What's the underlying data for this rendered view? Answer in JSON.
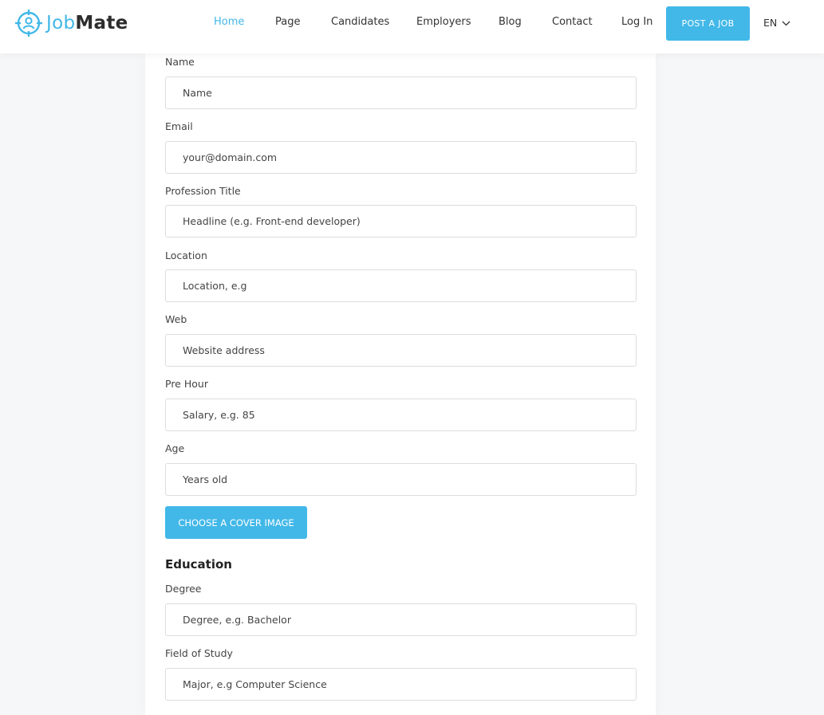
{
  "brand": {
    "part1": "Job",
    "part2": "Mate",
    "accent": "#42b8e8",
    "icon": "target-person-icon"
  },
  "nav": {
    "items": [
      {
        "label": "Home",
        "active": true
      },
      {
        "label": "Page"
      },
      {
        "label": "Candidates"
      },
      {
        "label": "Employers"
      },
      {
        "label": "Blog"
      },
      {
        "label": "Contact"
      },
      {
        "label": "Log In"
      }
    ],
    "post_job": "POST A JOB",
    "language": "EN",
    "language_icon": "chevron-down-icon"
  },
  "form": {
    "name": {
      "label": "Name",
      "placeholder": "Name"
    },
    "email": {
      "label": "Email",
      "placeholder": "your@domain.com"
    },
    "profession": {
      "label": "Profession Title",
      "placeholder": "Headline (e.g. Front-end developer)"
    },
    "location": {
      "label": "Location",
      "placeholder": "Location, e.g"
    },
    "web": {
      "label": "Web",
      "placeholder": "Website address"
    },
    "pre_hour": {
      "label": "Pre Hour",
      "placeholder": "Salary, e.g. 85"
    },
    "age": {
      "label": "Age",
      "placeholder": "Years old"
    },
    "cover_button": "CHOOSE A COVER IMAGE"
  },
  "education": {
    "title": "Education",
    "degree": {
      "label": "Degree",
      "placeholder": "Degree, e.g. Bachelor"
    },
    "field_of_study": {
      "label": "Field of Study",
      "placeholder": "Major, e.g Computer Science"
    }
  }
}
